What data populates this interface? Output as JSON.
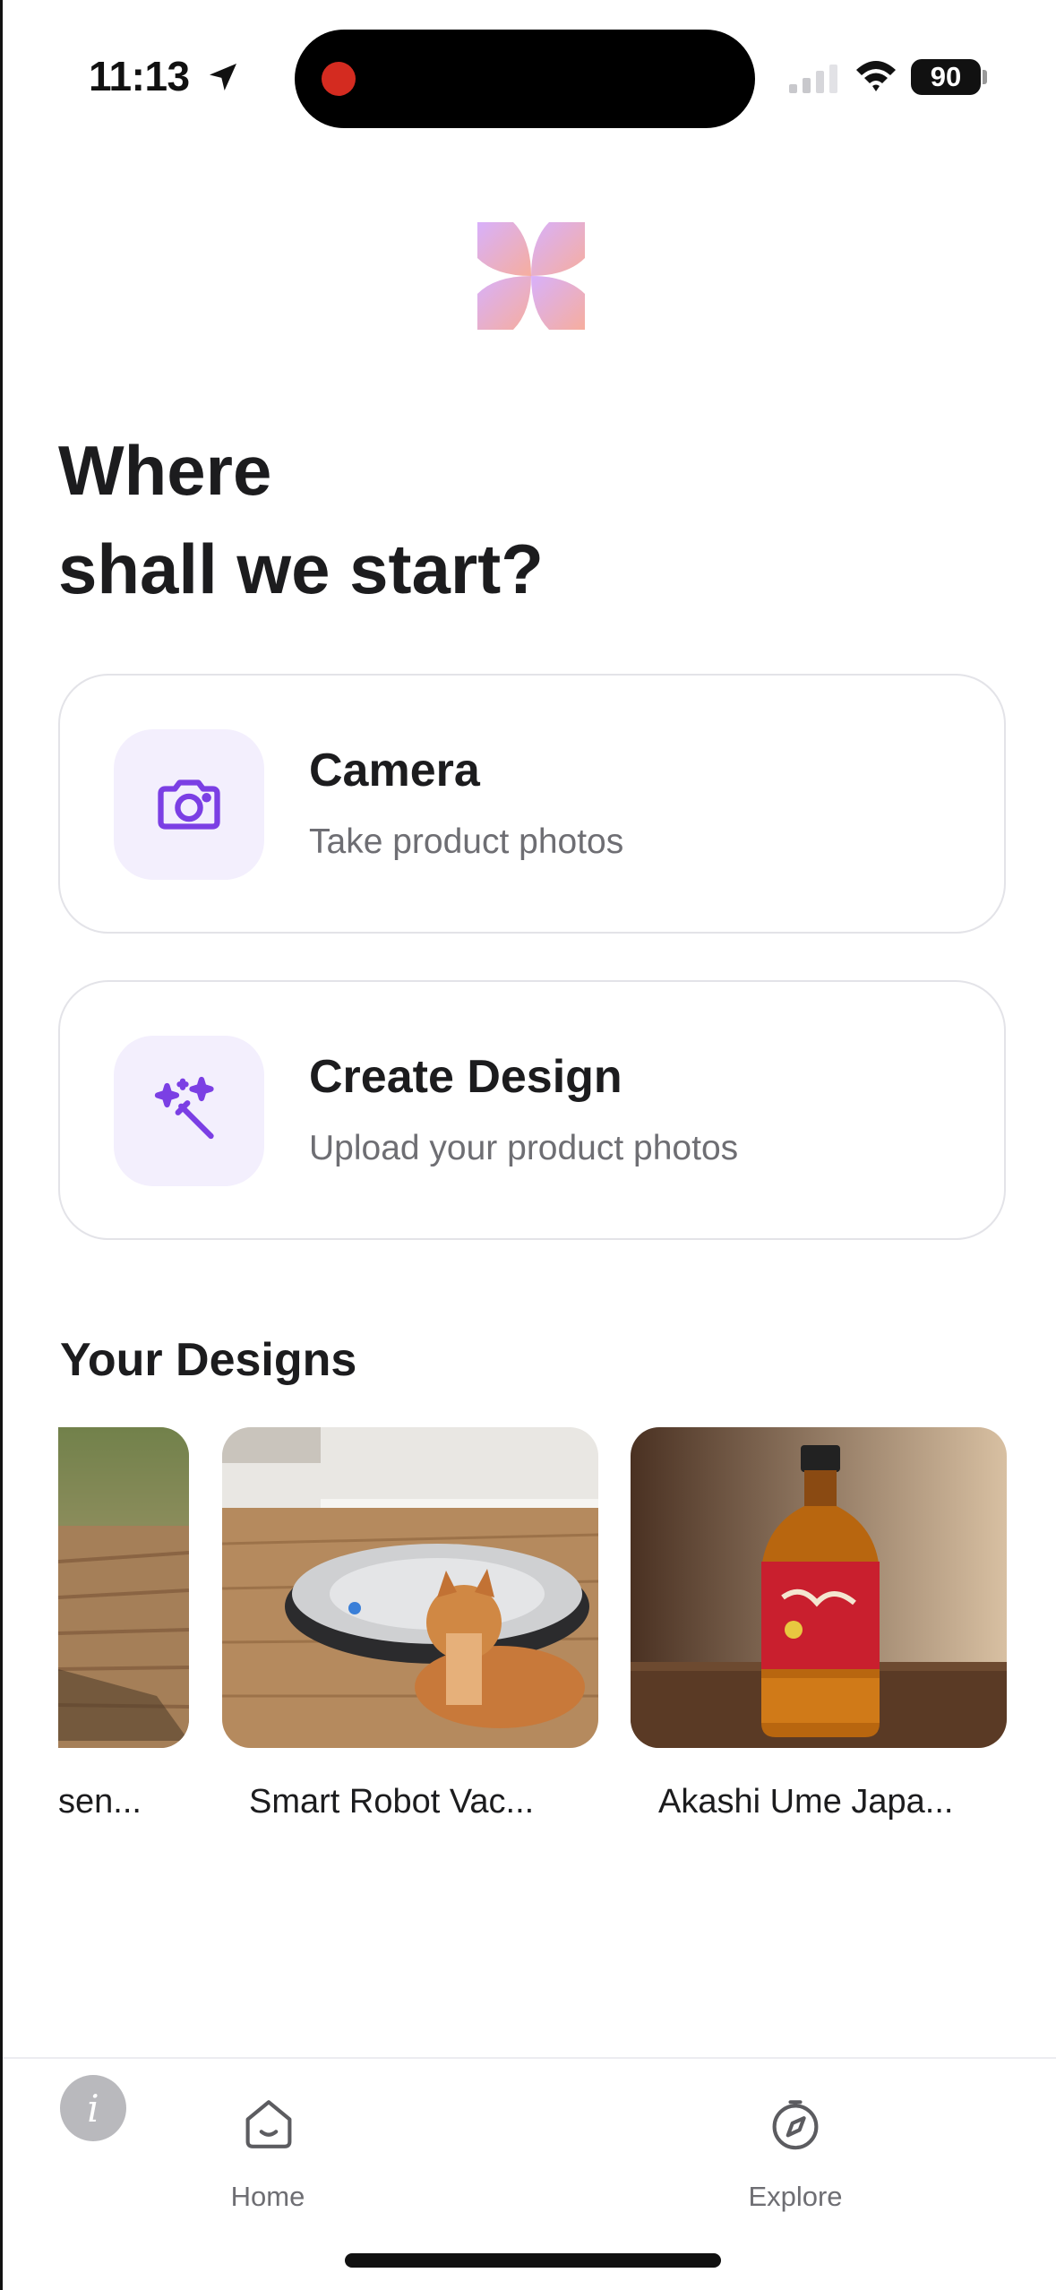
{
  "status_bar": {
    "time": "11:13",
    "battery": "90",
    "icons": [
      "location-arrow-icon",
      "recording-dot-icon",
      "cellular-signal-icon",
      "wifi-icon",
      "battery-icon"
    ]
  },
  "logo": {
    "icon": "pinwheel-logo",
    "colors": [
      "#d8b4f8",
      "#f4b0a8"
    ]
  },
  "heading": {
    "line1": "Where",
    "line2": "shall we start?"
  },
  "options": [
    {
      "title": "Camera",
      "subtitle": "Take product photos",
      "icon": "camera-icon"
    },
    {
      "title": "Create Design",
      "subtitle": "Upload your product photos",
      "icon": "magic-wand-icon"
    }
  ],
  "designs": {
    "title": "Your Designs",
    "items": [
      {
        "label": "sen..."
      },
      {
        "label": "Smart Robot Vac..."
      },
      {
        "label": "Akashi Ume Japa..."
      }
    ]
  },
  "tabbar": {
    "info_glyph": "i",
    "tabs": [
      {
        "label": "Home",
        "icon": "home-icon"
      },
      {
        "label": "Explore",
        "icon": "compass-icon"
      }
    ]
  },
  "colors": {
    "accent": "#7b3fe4",
    "icon_bg": "#f3effd",
    "text_primary": "#1c1c1e",
    "text_secondary": "#6e6e73",
    "card_border": "#e3e3e8"
  }
}
